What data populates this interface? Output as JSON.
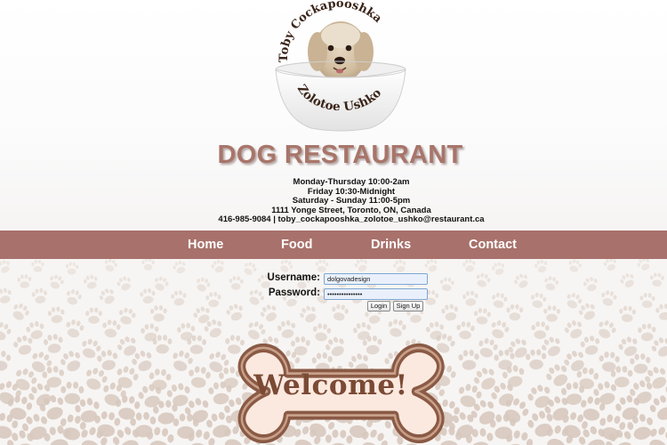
{
  "logo": {
    "top_text": "Toby Cockapooshka",
    "bottom_text": "Zolotoe Ushko"
  },
  "title": "DOG RESTAURANT",
  "info": {
    "hours_weekday": "Monday-Thursday 10:00-2am",
    "hours_friday": "Friday 10:30-Midnight",
    "hours_weekend": "Saturday - Sunday 11:00-5pm",
    "address": "1111 Yonge Street, Toronto, ON, Canada",
    "contact": "416-985-9084 | toby_cockapooshka_zolotoe_ushko@restaurant.ca"
  },
  "nav": {
    "home": "Home",
    "food": "Food",
    "drinks": "Drinks",
    "contact": "Contact"
  },
  "login": {
    "username_label": "Username:",
    "username_value": "dolgovadesign",
    "password_label": "Password:",
    "password_value": "•••••••••••••••",
    "login_button": "Login",
    "signup_button": "Sign Up"
  },
  "welcome": "Welcome!",
  "colors": {
    "accent": "#a8716b",
    "title": "#a8756a",
    "bone_outline": "#8a5a45",
    "bone_fill": "#fbe9df",
    "welcome_text": "#7a4a35"
  }
}
